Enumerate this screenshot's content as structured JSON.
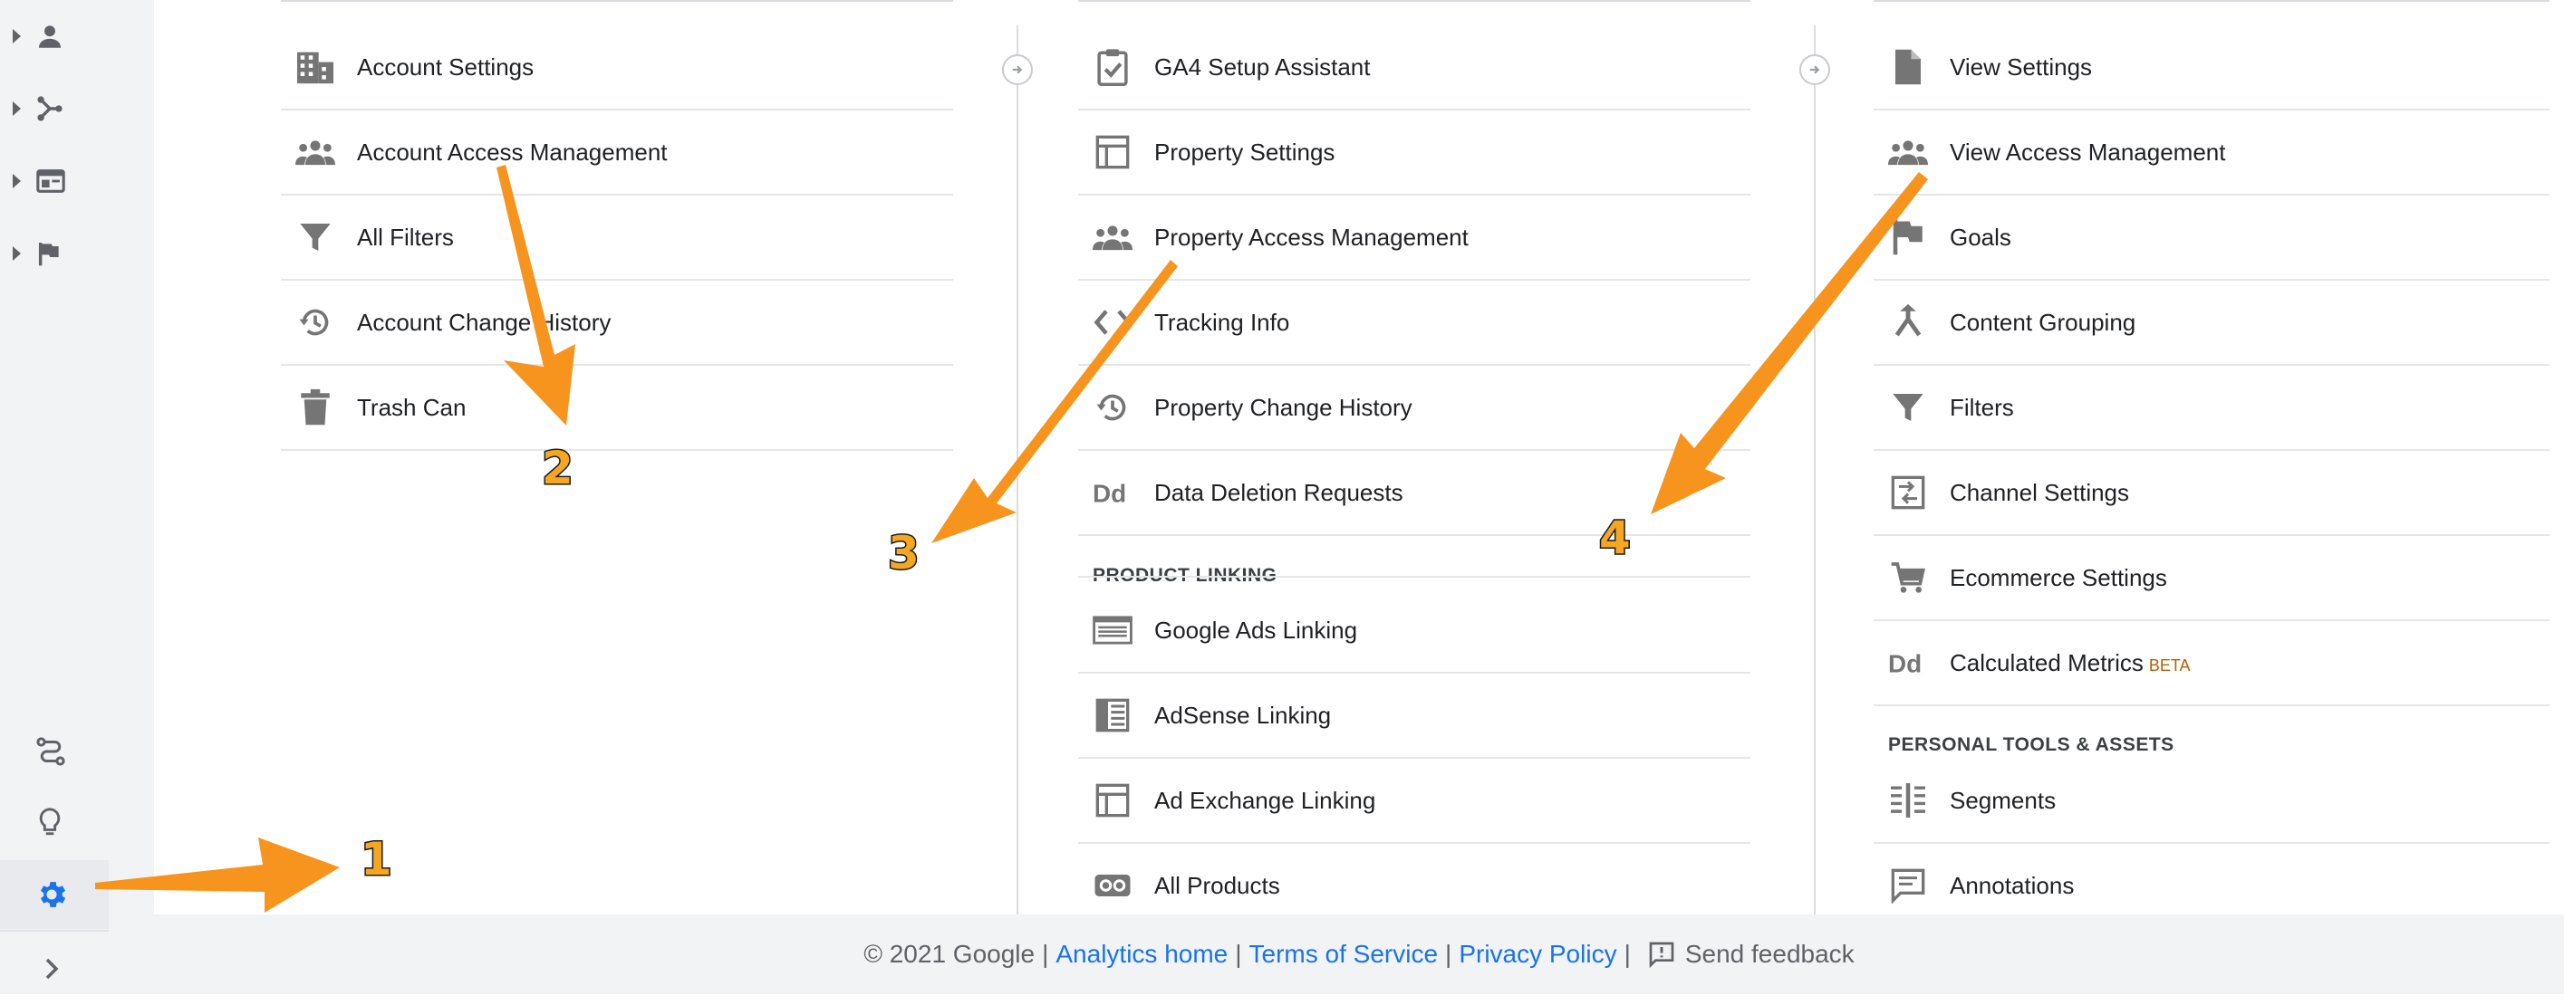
{
  "rail": {
    "top_icons": [
      "person-icon",
      "share-branch-icon",
      "browser-window-icon",
      "flag-icon"
    ],
    "bottom_icons": [
      "route-icon",
      "lightbulb-icon",
      "gear-icon",
      "chevron-right-icon"
    ],
    "active_color": "#1a73e8"
  },
  "account_column": {
    "items": [
      {
        "label": "Account Settings",
        "icon": "building-icon"
      },
      {
        "label": "Account Access Management",
        "icon": "people-icon"
      },
      {
        "label": "All Filters",
        "icon": "filter-icon"
      },
      {
        "label": "Account Change History",
        "icon": "history-icon"
      },
      {
        "label": "Trash Can",
        "icon": "trash-icon"
      }
    ]
  },
  "property_column": {
    "items": [
      {
        "label": "GA4 Setup Assistant",
        "icon": "clipboard-check-icon"
      },
      {
        "label": "Property Settings",
        "icon": "layout-icon"
      },
      {
        "label": "Property Access Management",
        "icon": "people-icon"
      },
      {
        "label": "Tracking Info",
        "icon": "code-icon"
      },
      {
        "label": "Property Change History",
        "icon": "history-icon"
      },
      {
        "label": "Data Deletion Requests",
        "icon": "dd-icon"
      }
    ],
    "section_label": "PRODUCT LINKING",
    "linking_items": [
      {
        "label": "Google Ads Linking",
        "icon": "ads-icon"
      },
      {
        "label": "AdSense Linking",
        "icon": "adsense-icon"
      },
      {
        "label": "Ad Exchange Linking",
        "icon": "layout-icon"
      },
      {
        "label": "All Products",
        "icon": "link-icon"
      }
    ]
  },
  "view_column": {
    "items": [
      {
        "label": "View Settings",
        "icon": "document-icon"
      },
      {
        "label": "View Access Management",
        "icon": "people-icon"
      },
      {
        "label": "Goals",
        "icon": "flag-icon"
      },
      {
        "label": "Content Grouping",
        "icon": "merge-icon"
      },
      {
        "label": "Filters",
        "icon": "filter-icon"
      },
      {
        "label": "Channel Settings",
        "icon": "channel-icon"
      },
      {
        "label": "Ecommerce Settings",
        "icon": "cart-icon"
      },
      {
        "label": "Calculated Metrics",
        "icon": "dd-icon",
        "badge": "BETA"
      }
    ],
    "section_label": "PERSONAL TOOLS & ASSETS",
    "tools_items": [
      {
        "label": "Segments",
        "icon": "segments-icon"
      },
      {
        "label": "Annotations",
        "icon": "comment-icon"
      }
    ]
  },
  "footer": {
    "copyright": "© 2021 Google",
    "separator": "|",
    "analytics_home": "Analytics home",
    "terms": "Terms of Service",
    "privacy": "Privacy Policy",
    "feedback": "Send feedback"
  },
  "annotations": {
    "numbers": [
      "1",
      "2",
      "3",
      "4"
    ],
    "arrow_color": "#f7941d"
  }
}
